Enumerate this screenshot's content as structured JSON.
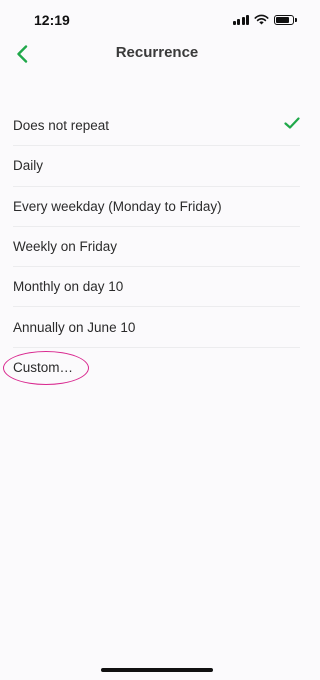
{
  "status_bar": {
    "time": "12:19",
    "icons": [
      "cellular-signal-icon",
      "wifi-icon",
      "battery-icon"
    ]
  },
  "header": {
    "title": "Recurrence",
    "back_icon": "chevron-left-icon"
  },
  "colors": {
    "accent": "#20a84a",
    "highlight": "#d9288f",
    "background": "#fbfafc",
    "divider": "#ececee"
  },
  "options": [
    {
      "label": "Does not repeat",
      "selected": true
    },
    {
      "label": "Daily",
      "selected": false
    },
    {
      "label": "Every weekday (Monday to Friday)",
      "selected": false
    },
    {
      "label": "Weekly on Friday",
      "selected": false
    },
    {
      "label": "Monthly on day 10",
      "selected": false
    },
    {
      "label": "Annually on June 10",
      "selected": false
    },
    {
      "label": "Custom…",
      "selected": false,
      "highlighted": true
    }
  ]
}
